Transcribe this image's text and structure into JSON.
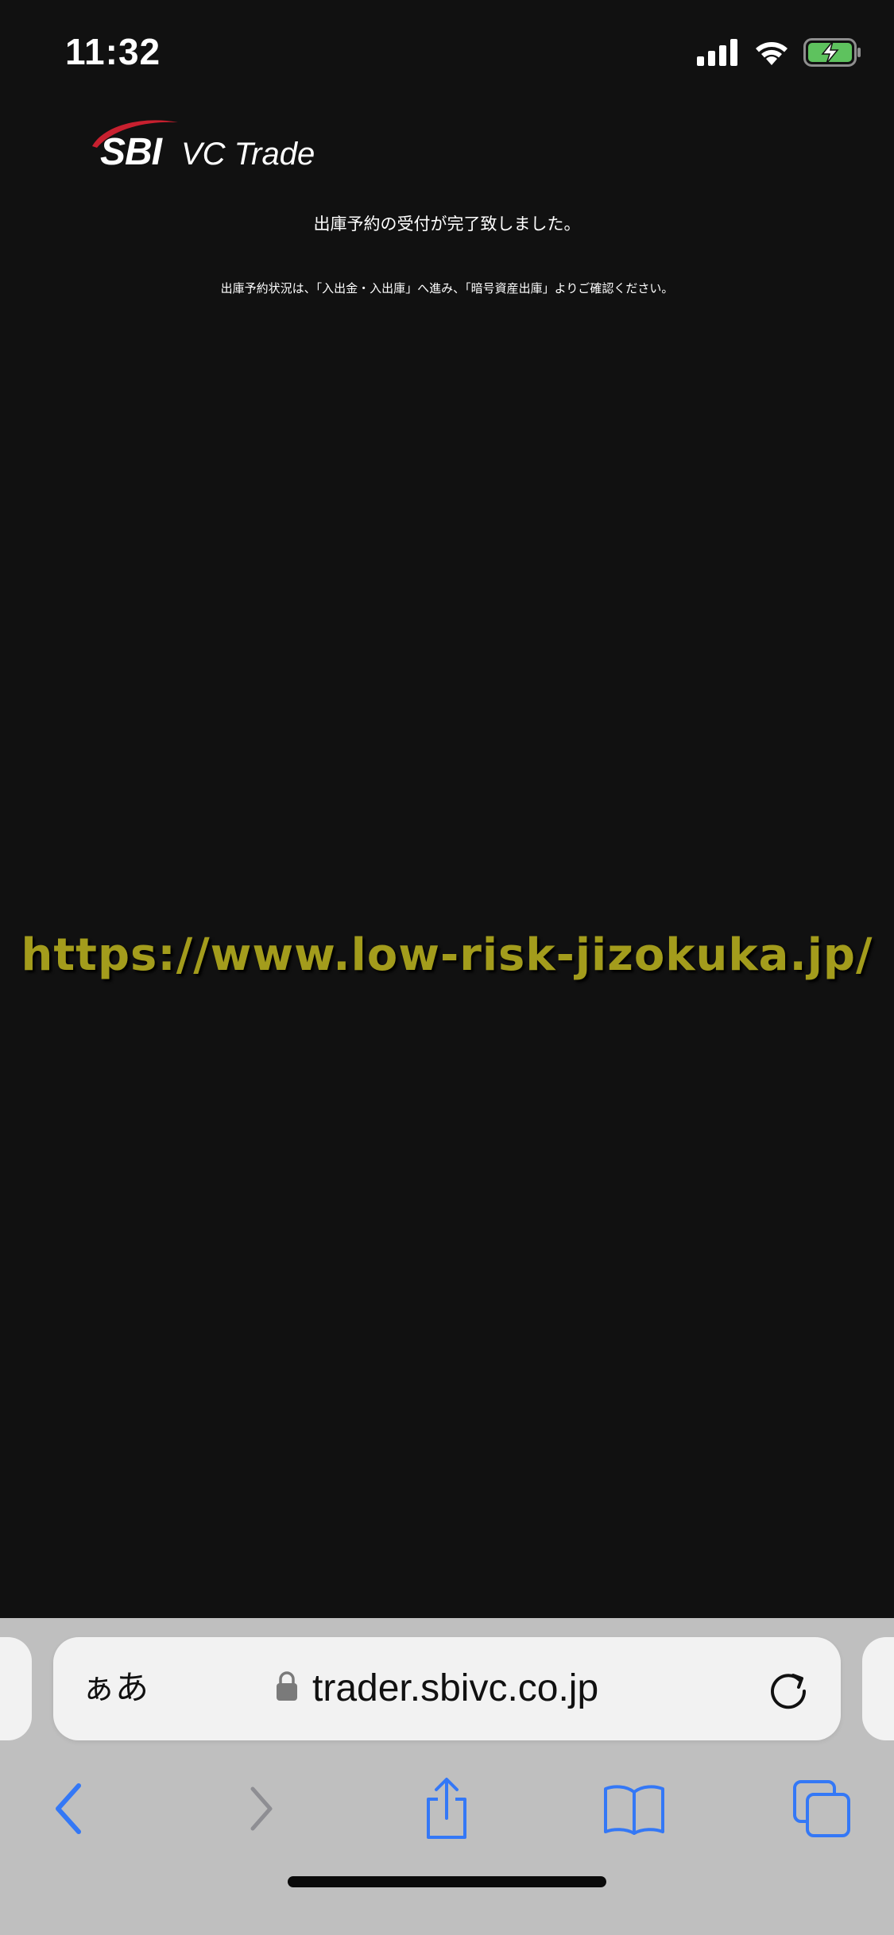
{
  "status_bar": {
    "time": "11:32",
    "icons": [
      "cellular-signal-icon",
      "wifi-icon",
      "battery-charging-icon"
    ]
  },
  "logo": {
    "sbi": "SBI",
    "vc_trade": "VC Trade",
    "swoosh_color": "#c8202f"
  },
  "content": {
    "message": "出庫予約の受付が完了致しました。",
    "note": "出庫予約状況は、「入出金・入出庫」へ進み、「暗号資産出庫」よりご確認ください。"
  },
  "watermark": {
    "text": "https://www.low-risk-jizokuka.jp/",
    "color": "#a39c1c"
  },
  "browser": {
    "aa_label": "ぁあ",
    "url": "trader.sbivc.co.jp",
    "toolbar_icons": [
      "back-icon",
      "forward-icon",
      "share-icon",
      "bookmarks-icon",
      "tabs-icon"
    ],
    "accent_color": "#3478f6"
  }
}
